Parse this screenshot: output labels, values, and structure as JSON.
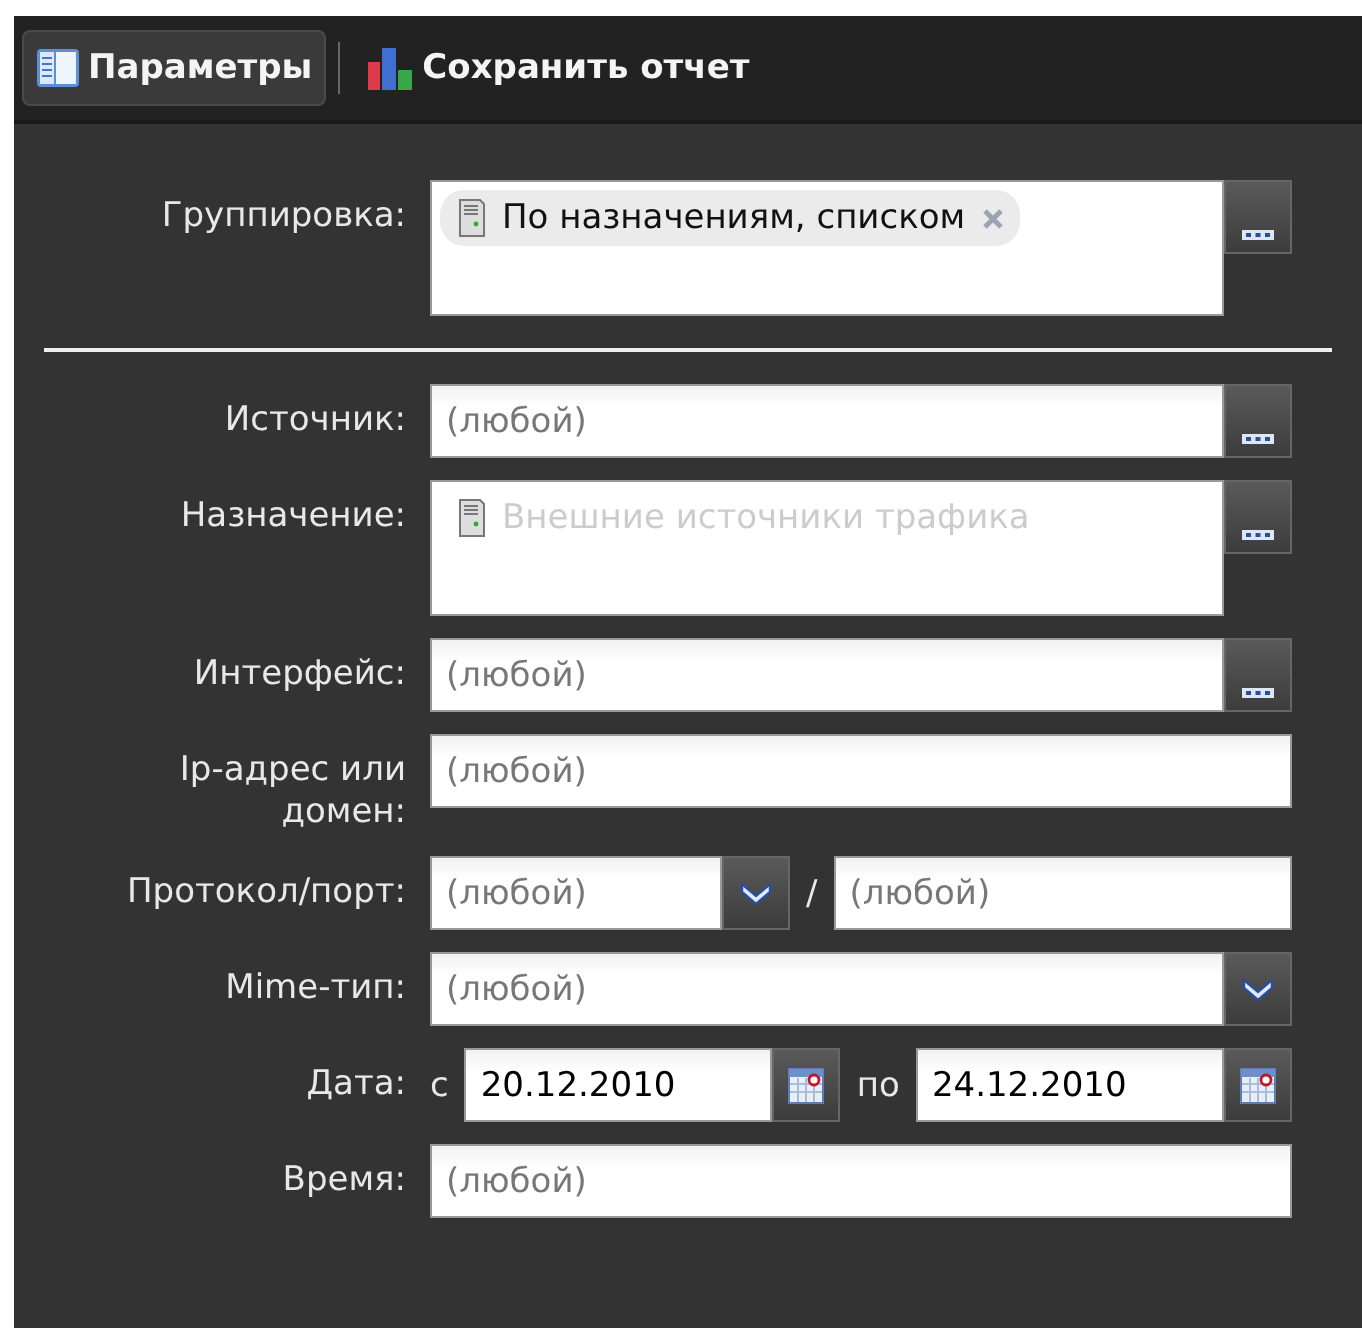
{
  "toolbar": [
    {
      "kind": "params",
      "label": "Параметры",
      "selected": true
    },
    {
      "kind": "report",
      "label": "Сохранить отчет",
      "selected": false
    }
  ],
  "sections": [
    [
      {
        "kind": "tag_picker",
        "label": "Группировка:",
        "tags": [
          {
            "text": "По назначениям, списком",
            "disabled": false
          }
        ]
      }
    ],
    [
      {
        "kind": "picker",
        "label": "Источник:",
        "placeholder": "(любой)"
      },
      {
        "kind": "tag_picker",
        "label": "Назначение:",
        "tags": [
          {
            "text": "Внешние источники трафика",
            "disabled": true
          }
        ]
      },
      {
        "kind": "picker",
        "label": "Интерфейс:",
        "placeholder": "(любой)"
      },
      {
        "kind": "text",
        "label": "Ip-адрес или домен:",
        "placeholder": "(любой)"
      },
      {
        "kind": "combo_port",
        "label": "Протокол/порт:",
        "placeholder": "(любой)",
        "separator": "/",
        "port_placeholder": "(любой)"
      },
      {
        "kind": "combo",
        "label": "Mime-тип:",
        "placeholder": "(любой)"
      },
      {
        "kind": "date_range",
        "label": "Дата:",
        "from_label": "с",
        "from": "20.12.2010",
        "to_label": "по",
        "to": "24.12.2010"
      },
      {
        "kind": "text",
        "label": "Время:",
        "placeholder": "(любой)"
      }
    ]
  ]
}
